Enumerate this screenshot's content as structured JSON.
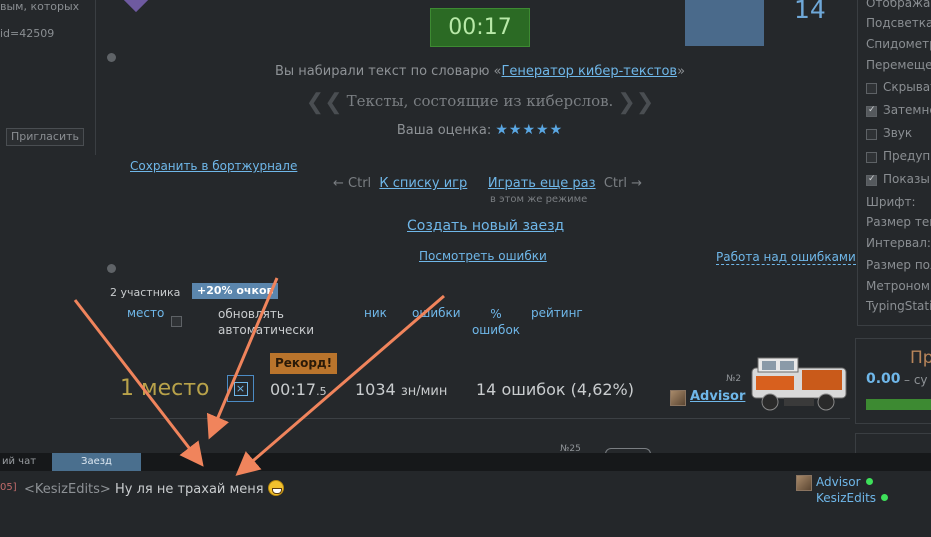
{
  "left": {
    "text_top": "вым, которых",
    "text_id": "id=42509",
    "invite_button": "Пригласить"
  },
  "timer": "00:17",
  "top_right_number": "14",
  "vocab": {
    "prefix": "Вы набирали текст по словарю «",
    "link": "Генератор кибер-текстов",
    "suffix": "»"
  },
  "quote": "Тексты, состоящие из киберслов.",
  "rating": {
    "label": "Ваша оценка:",
    "stars": 5
  },
  "links": {
    "save_log": "Сохранить в бортжурнале",
    "ctrl_left": "← Ctrl",
    "list_games": "К списку игр",
    "play_again": "Играть еще раз",
    "ctrl_right": "Ctrl →",
    "same_mode": "в этом же режиме",
    "new_race": "Создать новый заезд",
    "view_errors": "Посмотреть ошибки",
    "work_errors": "Работа над ошибками"
  },
  "results": {
    "participants": "2 участника",
    "bonus": "+20% очков",
    "headers": {
      "place": "место",
      "auto_update": "обновлять автоматически",
      "nick": "ник",
      "errors": "ошибки",
      "percent": "% ошибок",
      "rating": "рейтинг"
    },
    "record_badge": "Рекорд!",
    "row1": {
      "place": "1 место",
      "time_main": "00:17",
      "time_frac": ".5",
      "speed_value": "1034",
      "speed_unit": "зн/мин",
      "errors": "14 ошибок (4,62%)",
      "rank_no": "№2",
      "nick": "Advisor"
    },
    "row2": {
      "rank_no": "№25"
    }
  },
  "settings_panel": {
    "items": [
      {
        "label": "Отобража",
        "checkbox": false,
        "checked": false
      },
      {
        "label": "Подсветка",
        "checkbox": false,
        "checked": false
      },
      {
        "label": "Спидометр",
        "checkbox": false,
        "checked": false
      },
      {
        "label": "Перемеще",
        "checkbox": false,
        "checked": false
      },
      {
        "label": "Скрыват",
        "checkbox": true,
        "checked": false
      },
      {
        "label": "Затемне",
        "checkbox": true,
        "checked": true
      },
      {
        "label": "Звук",
        "checkbox": true,
        "checked": false
      },
      {
        "label": "Предупр",
        "checkbox": true,
        "checked": false
      },
      {
        "label": "Показы",
        "checkbox": true,
        "checked": true
      },
      {
        "label": "Шрифт:",
        "checkbox": false,
        "checked": false
      },
      {
        "label": "Размер тек",
        "checkbox": false,
        "checked": false
      },
      {
        "label": "Интервал:",
        "checkbox": false,
        "checked": false
      },
      {
        "label": "Размер пол",
        "checkbox": false,
        "checked": false
      },
      {
        "label": "Метроном:",
        "checkbox": false,
        "checked": false
      },
      {
        "label": "TypingStati",
        "checkbox": false,
        "checked": false
      }
    ]
  },
  "mini_box": {
    "title": "Пр",
    "value": "0.00",
    "suffix": "– су"
  },
  "chat": {
    "tab_general": "ий чат",
    "tab_race": "Заезд",
    "time": "05]",
    "sender": "<KesizEdits>",
    "message": "Ну ля не трахай меня",
    "users": [
      "Advisor",
      "KesizEdits"
    ]
  },
  "colors": {
    "background": "#25282b",
    "link": "#6fb7e9",
    "timer_bg": "#2b6a24",
    "place": "#b8a24a",
    "record": "#b9742c",
    "annotation_arrow": "#f0845c"
  }
}
